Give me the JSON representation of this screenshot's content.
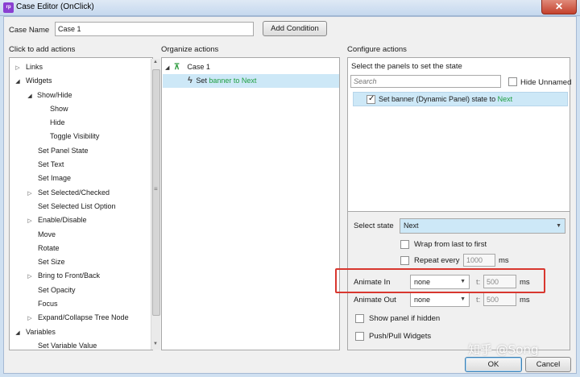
{
  "window": {
    "title": "Case Editor (OnClick)",
    "app_icon": "rp",
    "close_glyph": "✕"
  },
  "case_name": {
    "label": "Case Name",
    "value": "Case 1",
    "add_condition": "Add Condition"
  },
  "left": {
    "heading": "Click to add actions",
    "items": [
      {
        "label": "Links"
      },
      {
        "label": "Widgets"
      },
      {
        "label": "Show/Hide"
      },
      {
        "label": "Show"
      },
      {
        "label": "Hide"
      },
      {
        "label": "Toggle Visibility"
      },
      {
        "label": "Set Panel State"
      },
      {
        "label": "Set Text"
      },
      {
        "label": "Set Image"
      },
      {
        "label": "Set Selected/Checked"
      },
      {
        "label": "Set Selected List Option"
      },
      {
        "label": "Enable/Disable"
      },
      {
        "label": "Move"
      },
      {
        "label": "Rotate"
      },
      {
        "label": "Set Size"
      },
      {
        "label": "Bring to Front/Back"
      },
      {
        "label": "Set Opacity"
      },
      {
        "label": "Focus"
      },
      {
        "label": "Expand/Collapse Tree Node"
      },
      {
        "label": "Variables"
      },
      {
        "label": "Set Variable Value"
      }
    ]
  },
  "middle": {
    "heading": "Organize actions",
    "case_label": "Case 1",
    "action_prefix": "Set",
    "action_target": "banner to Next"
  },
  "right": {
    "heading": "Configure actions",
    "panel_title": "Select the panels to set the state",
    "search_placeholder": "Search",
    "hide_unnamed": "Hide Unnamed",
    "panel_item_prefix": "Set banner (Dynamic Panel) state to",
    "panel_item_state": "Next",
    "select_state_label": "Select state",
    "select_state_value": "Next",
    "wrap_label": "Wrap from last to first",
    "repeat_label": "Repeat every",
    "repeat_value": "1000",
    "repeat_unit": "ms",
    "animate_in_label": "Animate In",
    "animate_in_value": "none",
    "animate_in_t": "t:",
    "animate_in_time": "500",
    "animate_in_unit": "ms",
    "animate_out_label": "Animate Out",
    "animate_out_value": "none",
    "animate_out_t": "t:",
    "animate_out_time": "500",
    "animate_out_unit": "ms",
    "show_panel_label": "Show panel if hidden",
    "push_pull_label": "Push/Pull Widgets"
  },
  "footer": {
    "ok": "OK",
    "cancel": "Cancel",
    "watermark": "知乎 @Song"
  },
  "colors": {
    "accent": "#1d9d3f",
    "selection": "#cde8f7",
    "highlight": "#d8372f"
  }
}
